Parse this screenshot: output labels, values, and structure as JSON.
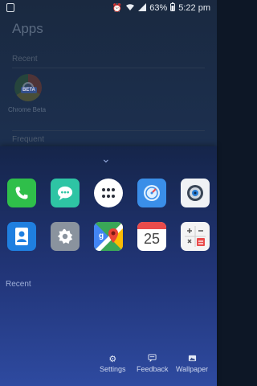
{
  "status_bar": {
    "battery": "63%",
    "time": "5:22 pm",
    "icons": [
      "screenshot-icon",
      "alarm-icon",
      "wifi-icon",
      "signal-icon",
      "battery-icon"
    ]
  },
  "background_drawer": {
    "title": "Apps",
    "recent_label": "Recent",
    "recent_app": {
      "name": "Chrome Beta",
      "badge": "BETA",
      "icon": "chrome-beta-icon"
    },
    "frequent_label": "Frequent"
  },
  "panel": {
    "apps": [
      {
        "name": "Phone",
        "icon": "phone-icon",
        "color": "#2fbf4a"
      },
      {
        "name": "Messages",
        "icon": "message-icon",
        "color": "#2ec4a4"
      },
      {
        "name": "App Drawer",
        "icon": "apps-grid-icon",
        "color": "#ffffff"
      },
      {
        "name": "Speed",
        "icon": "compass-icon",
        "color": "#3a8ee8"
      },
      {
        "name": "Camera",
        "icon": "camera-icon",
        "color": "#f0f2f5"
      },
      {
        "name": "Contacts",
        "icon": "contacts-icon",
        "color": "#1f7fe0"
      },
      {
        "name": "Settings",
        "icon": "gear-icon",
        "color": "#8a939e"
      },
      {
        "name": "Maps",
        "icon": "maps-icon",
        "color": "#e8e8e8"
      },
      {
        "name": "Calendar",
        "icon": "calendar-icon",
        "color": "#ffffff",
        "date": "25"
      },
      {
        "name": "Calculator",
        "icon": "calculator-icon",
        "color": "#f4f4f4"
      }
    ],
    "recent_label": "Recent",
    "actions": [
      {
        "label": "Settings",
        "icon": "gear-icon"
      },
      {
        "label": "Feedback",
        "icon": "feedback-icon"
      },
      {
        "label": "Wallpaper",
        "icon": "wallpaper-icon"
      }
    ]
  }
}
